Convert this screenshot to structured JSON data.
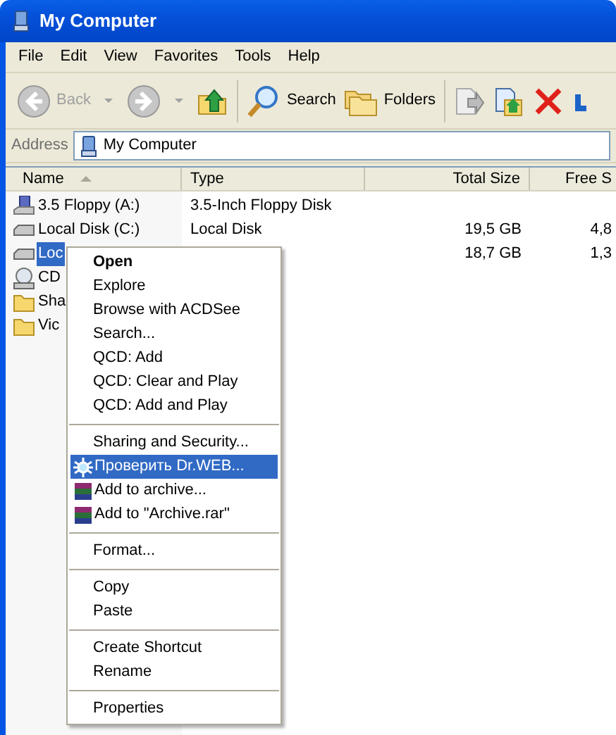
{
  "window": {
    "title": "My Computer"
  },
  "menu_bar": [
    "File",
    "Edit",
    "View",
    "Favorites",
    "Tools",
    "Help"
  ],
  "toolbar": [
    {
      "kind": "back",
      "label": "Back",
      "disabled": true
    },
    {
      "kind": "forward",
      "disabled": true
    },
    {
      "kind": "up"
    },
    {
      "kind": "search",
      "label": "Search"
    },
    {
      "kind": "folders",
      "label": "Folders"
    },
    {
      "kind": "move"
    },
    {
      "kind": "copy"
    },
    {
      "kind": "delete"
    },
    {
      "kind": "undo"
    }
  ],
  "address": {
    "label": "Address",
    "value": "My Computer"
  },
  "table": {
    "columns": [
      "Name",
      "Type",
      "Total Size",
      "Free S"
    ],
    "rows": [
      {
        "kind": "floppy",
        "name": "3.5 Floppy (A:)",
        "type": "3.5-Inch Floppy Disk",
        "total_size": "",
        "free": "",
        "selected": false
      },
      {
        "kind": "disk",
        "name": "Local Disk (C:)",
        "type": "Local Disk",
        "total_size": "19,5 GB",
        "free": "4,8",
        "selected": false
      },
      {
        "kind": "disk",
        "name": "Loc",
        "type": "",
        "total_size": "18,7 GB",
        "free": "1,3",
        "selected": true
      },
      {
        "kind": "cd",
        "name": "CD",
        "type": "",
        "total_size": "",
        "free": "",
        "selected": false
      },
      {
        "kind": "folder",
        "name": "Sha",
        "type": "",
        "total_size": "",
        "free": "",
        "selected": false
      },
      {
        "kind": "folder",
        "name": "Vic",
        "type": "",
        "total_size": "",
        "free": "",
        "selected": false
      }
    ]
  },
  "context_menu": [
    {
      "kind": "item",
      "label": "Open",
      "default": true,
      "selected": false
    },
    {
      "kind": "item",
      "label": "Explore",
      "selected": false
    },
    {
      "kind": "item",
      "label": "Browse with ACDSee",
      "selected": false
    },
    {
      "kind": "item",
      "label": "Search...",
      "selected": false
    },
    {
      "kind": "item",
      "label": "QCD: Add",
      "selected": false
    },
    {
      "kind": "item",
      "label": "QCD: Clear and Play",
      "selected": false
    },
    {
      "kind": "item",
      "label": "QCD: Add and Play",
      "selected": false
    },
    {
      "kind": "separator"
    },
    {
      "kind": "item",
      "label": "Sharing and Security...",
      "selected": false
    },
    {
      "kind": "scan",
      "label": "Проверить Dr.WEB...",
      "selected": true
    },
    {
      "kind": "archive",
      "label": "Add to archive...",
      "selected": false
    },
    {
      "kind": "archive",
      "label": "Add to \"Archive.rar\"",
      "selected": false
    },
    {
      "kind": "separator"
    },
    {
      "kind": "item",
      "label": "Format...",
      "selected": false
    },
    {
      "kind": "separator"
    },
    {
      "kind": "item",
      "label": "Copy",
      "selected": false
    },
    {
      "kind": "item",
      "label": "Paste",
      "selected": false
    },
    {
      "kind": "separator"
    },
    {
      "kind": "item",
      "label": "Create Shortcut",
      "selected": false
    },
    {
      "kind": "item",
      "label": "Rename",
      "selected": false
    },
    {
      "kind": "separator"
    },
    {
      "kind": "item",
      "label": "Properties",
      "selected": false
    }
  ]
}
